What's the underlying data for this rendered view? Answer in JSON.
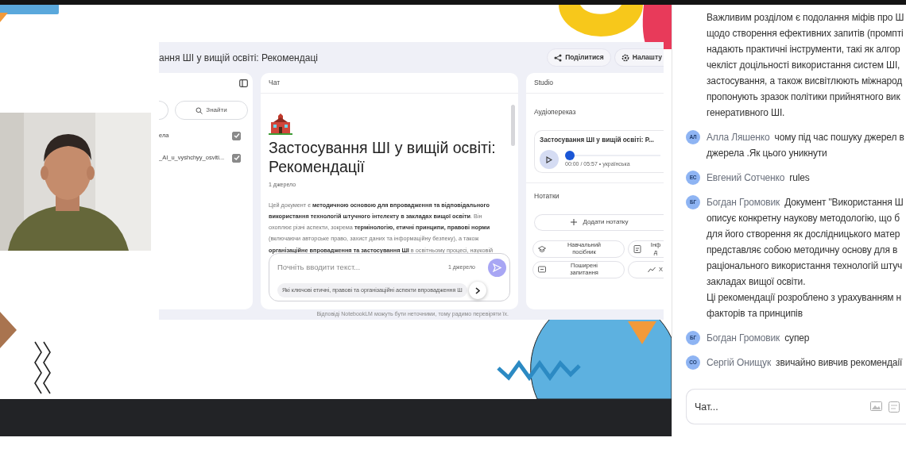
{
  "shared_screen": {
    "title": "ання ШІ у вищій освіті: Рекомендаці",
    "header_buttons": [
      {
        "kind": "share",
        "label": "Поділитися"
      },
      {
        "kind": "settings",
        "label": "Налашту"
      }
    ],
    "sources": {
      "search_button": "Знайти",
      "items": [
        {
          "label": "ела",
          "checked": true
        },
        {
          "label": "_AI_u_vyshchyy_osviti...",
          "checked": true
        }
      ]
    },
    "chat": {
      "header": "Чат",
      "title": "Застосування ШІ у вищій освіті: Рекомендації",
      "source_count": "1 джерело",
      "summary": "Цей документ є **методичною основою для впровадження та відповідального використання технологій штучного інтелекту в закладах вищої освіти**. Він охоплює різні аспекти, зокрема **термінологію, етичні принципи, правові норми** (включаючи авторське право, захист даних та інформаційну безпеку), а також **організаційне впровадження та застосування ШІ** в освітньому процесі, науковій",
      "input": {
        "placeholder": "Почніть вводити текст...",
        "source_count": "1 джерело"
      },
      "suggestion": "Які ключові етичні, правові та організаційні аспекти впровадження Ш"
    },
    "studio": {
      "header": "Studio",
      "audio_section": "Аудіопереказ",
      "audio": {
        "title": "Застосування ШІ у вищій освіті: Р...",
        "level": 0,
        "time": "00:00 / 05:57 • українська"
      },
      "notes_section": "Нотатки",
      "add_note": "Додати нотатку",
      "tools": [
        {
          "kind": "guide",
          "label": "Навчальний посібник"
        },
        {
          "kind": "doc",
          "label": "Інф д"
        },
        {
          "kind": "faq",
          "label": "Поширені запитання"
        },
        {
          "kind": "trend",
          "label": "Х"
        }
      ]
    },
    "disclaimer": "Відповіді NotebookLM можуть бути неточними, тому радимо перевіряти їх."
  },
  "chat_panel": {
    "messages": [
      {
        "lines": [
          "Важливим розділом є подолання міфів про Ш",
          "щодо створення ефективних запитів (промпті",
          "надають практичні інструменти, такі як алгор",
          "чекліст доцільності використання систем ШІ,",
          "застосування, а також висвітлюють міжнарод",
          "пропонують зразок політики прийнятного вик",
          "генеративного ШІ."
        ]
      },
      {
        "author": "Алла Ляшенко",
        "initials": "АЛ",
        "lines": [
          "чому під час пошуку джерел в",
          "джерела .Як цього уникнути"
        ]
      },
      {
        "author": "Евгений Сотченко",
        "initials": "ЕС",
        "lines": [
          "rules"
        ]
      },
      {
        "author": "Богдан Громовик",
        "initials": "БГ",
        "lines": [
          "Документ \"Використання Ш",
          "описує конкретну наукову методологію, що б",
          "для його створення як дослідницького матер",
          "представляє собою методичну основу для в",
          "раціонального використання технологій штуч",
          "закладах вищої освіти.",
          "Ці рекомендації розроблено з урахуванням н",
          "факторів та принципів"
        ]
      },
      {
        "author": "Богдан Громовик",
        "initials": "БГ",
        "lines": [
          "супер"
        ]
      },
      {
        "author": "Сергій Онищук",
        "initials": "СО",
        "lines": [
          "звичайно вивчив рекомендаії"
        ]
      }
    ],
    "input": {
      "placeholder": "Чат..."
    }
  }
}
